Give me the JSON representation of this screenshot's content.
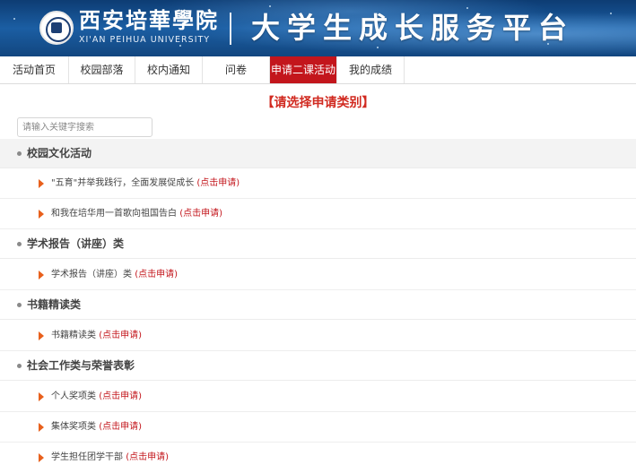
{
  "header": {
    "school_name": "西安培華學院",
    "school_name_en": "XI'AN PEIHUA UNIVERSITY",
    "platform_title": "大学生成长服务平台",
    "logo": "school-seal-logo"
  },
  "nav": {
    "items": [
      {
        "label": "活动首页",
        "active": false
      },
      {
        "label": "校园部落",
        "active": false
      },
      {
        "label": "校内通知",
        "active": false
      },
      {
        "label": "问卷",
        "active": false
      },
      {
        "label": "申请二课活动积",
        "active": true
      },
      {
        "label": "我的成绩",
        "active": false
      }
    ]
  },
  "main": {
    "heading": "【请选择申请类别】",
    "search_placeholder": "请输入关键字搜索",
    "categories": [
      {
        "label": "校园文化活动",
        "items": [
          {
            "text": "\"五育\"并举我践行，全面发展促成长",
            "apply": "(点击申请)"
          },
          {
            "text": "和我在培华用一首歌向祖国告白",
            "apply": "(点击申请)"
          }
        ]
      },
      {
        "label": "学术报告（讲座）类",
        "items": [
          {
            "text": "学术报告（讲座）类",
            "apply": "(点击申请)"
          }
        ]
      },
      {
        "label": "书籍精读类",
        "items": [
          {
            "text": "书籍精读类",
            "apply": "(点击申请)"
          }
        ]
      },
      {
        "label": "社会工作类与荣誉表彰",
        "items": [
          {
            "text": "个人奖项类",
            "apply": "(点击申请)"
          },
          {
            "text": "集体奖项类",
            "apply": "(点击申请)"
          },
          {
            "text": "学生担任团学干部",
            "apply": "(点击申请)"
          }
        ]
      }
    ]
  },
  "colors": {
    "accent_red": "#c3161c",
    "arrow_orange": "#e8601c",
    "banner_blue": "#1b5ea3"
  }
}
